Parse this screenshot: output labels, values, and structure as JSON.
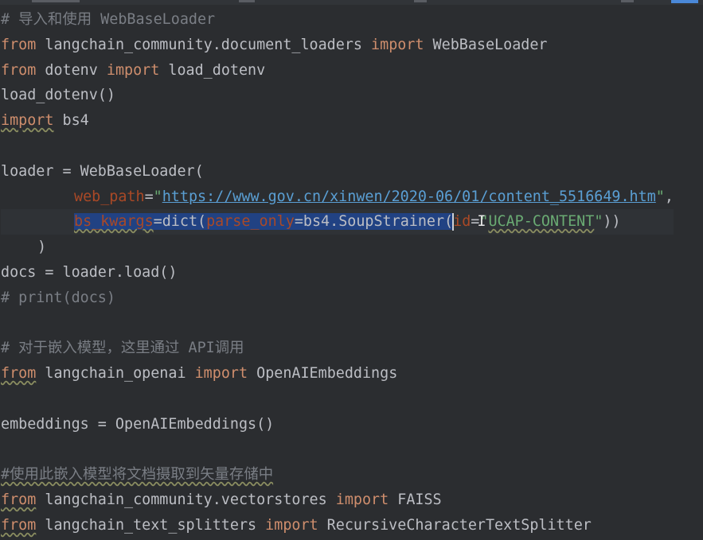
{
  "colors": {
    "background": "#2b2d30",
    "keyword": "#cf8e6d",
    "comment": "#7a7e85",
    "string": "#6aab73",
    "url": "#5a9fd4",
    "parameter": "#aa4926",
    "selection": "#214283",
    "text": "#bcbec4"
  },
  "code": {
    "l1": {
      "comment": "# 导入和使用 WebBaseLoader"
    },
    "l2": {
      "kw1": "from",
      "mod": " langchain_community.document_loaders ",
      "kw2": "import",
      "name": " WebBaseLoader"
    },
    "l3": {
      "kw1": "from",
      "mod": " dotenv ",
      "kw2": "import",
      "name": " load_dotenv"
    },
    "l4": {
      "text": "load_dotenv()"
    },
    "l5": {
      "kw": "import",
      "name": " bs4"
    },
    "l7": {
      "text": "loader = WebBaseLoader("
    },
    "l8": {
      "param": "web_path",
      "eq": "=",
      "quote_open": "\"",
      "url": "https://www.gov.cn/xinwen/2020-06/01/content_5516649.htm",
      "quote_close": "\"",
      "comma": ","
    },
    "l9": {
      "param1": "bs_kwargs",
      "t1": "=dict(",
      "param2": "parse_only",
      "t2": "=bs4.SoupStrainer(",
      "param3": "id",
      "eq": "=",
      "ibeam": "I",
      "quote_open": "\"",
      "str_val": "UCAP-CONTENT",
      "quote_close": "\"",
      "close": "))"
    },
    "l10": {
      "text": ")"
    },
    "l11": {
      "text": "docs = loader.load()"
    },
    "l12": {
      "comment": "# print(docs)"
    },
    "l14": {
      "comment": "# 对于嵌入模型，这里通过 API调用"
    },
    "l15": {
      "kw1": "from",
      "mod": " langchain_openai ",
      "kw2": "import",
      "name": " OpenAIEmbeddings"
    },
    "l17": {
      "text": "embeddings = OpenAIEmbeddings()"
    },
    "l19": {
      "comment": "#使用此嵌入模型将文档摄取到矢量存储中"
    },
    "l20": {
      "kw1": "from",
      "mod": " langchain_community.vectorstores ",
      "kw2": "import",
      "name": " FAISS"
    },
    "l21": {
      "kw1": "from",
      "mod": " langchain_text_splitters ",
      "kw2": "import",
      "name": " RecursiveCharacterTextSplitter"
    }
  }
}
